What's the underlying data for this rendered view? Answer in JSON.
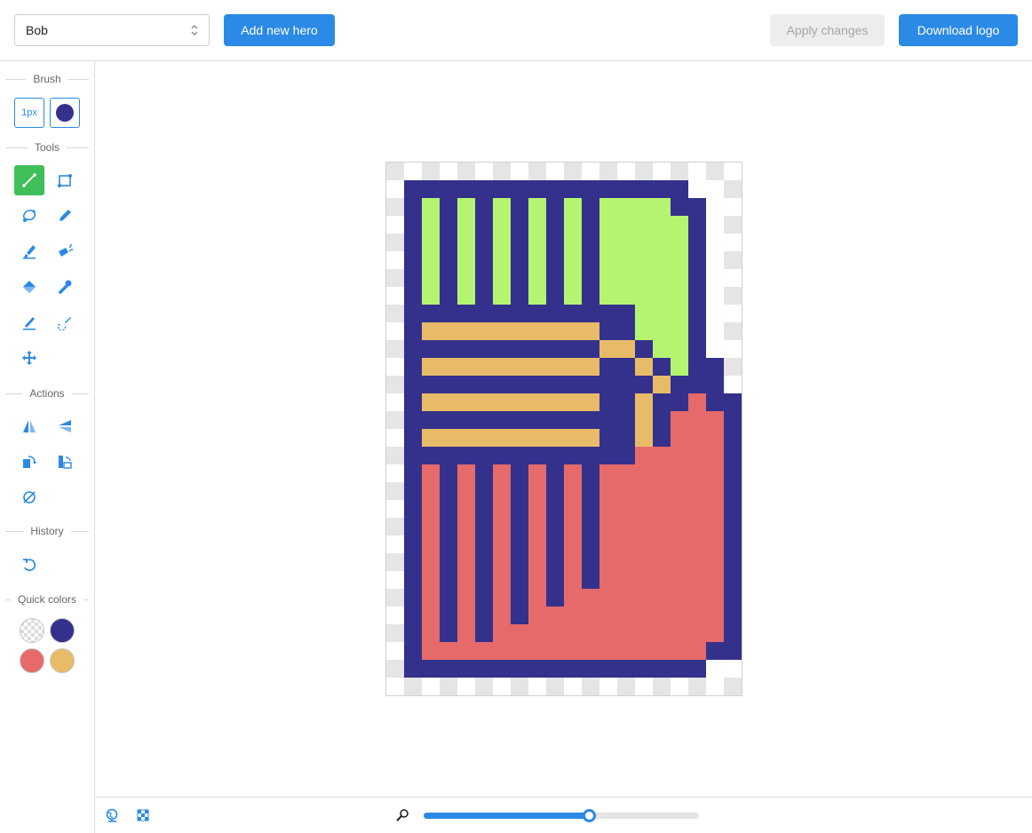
{
  "header": {
    "hero_select": {
      "value": "Bob"
    },
    "add_hero_label": "Add new hero",
    "apply_label": "Apply changes",
    "download_label": "Download logo"
  },
  "sidebar": {
    "brush": {
      "title": "Brush",
      "size_label": "1px",
      "color": "#34318c"
    },
    "tools": {
      "title": "Tools",
      "items": [
        {
          "name": "line-tool",
          "icon": "line-icon",
          "active": true
        },
        {
          "name": "rectangle-tool",
          "icon": "rectangle-select-icon",
          "active": false
        },
        {
          "name": "lasso-tool",
          "icon": "lasso-icon",
          "active": false
        },
        {
          "name": "pencil-tool",
          "icon": "pencil-icon",
          "active": false
        },
        {
          "name": "marker-tool",
          "icon": "marker-icon",
          "active": false
        },
        {
          "name": "spray-tool",
          "icon": "spray-icon",
          "active": false
        },
        {
          "name": "fill-tool",
          "icon": "paint-bucket-icon",
          "active": false
        },
        {
          "name": "eyedropper-tool",
          "icon": "eyedropper-icon",
          "active": false
        },
        {
          "name": "eraser-tool",
          "icon": "eraser-icon",
          "active": false
        },
        {
          "name": "color-replace-tool",
          "icon": "color-replace-icon",
          "active": false
        },
        {
          "name": "move-tool",
          "icon": "move-icon",
          "active": false
        }
      ]
    },
    "actions": {
      "title": "Actions",
      "items": [
        {
          "name": "flip-horizontal",
          "icon": "flip-horizontal-icon"
        },
        {
          "name": "flip-vertical",
          "icon": "flip-vertical-icon"
        },
        {
          "name": "rotate-right",
          "icon": "rotate-right-icon"
        },
        {
          "name": "rotate-left",
          "icon": "rotate-left-icon"
        },
        {
          "name": "clear",
          "icon": "clear-icon"
        }
      ]
    },
    "history": {
      "title": "History",
      "items": [
        {
          "name": "undo",
          "icon": "undo-icon"
        }
      ]
    },
    "quick_colors": {
      "title": "Quick colors",
      "items": [
        "transparent",
        "#34318c",
        "#e66a6a",
        "#e8bb68"
      ]
    }
  },
  "canvas": {
    "palette": {
      "B": "#34318c",
      "G": "#b5f471",
      "O": "#e8bb68",
      "R": "#e66a6a",
      "W": "#ffffff",
      "T1": "#ffffff",
      "T2": "#e5e5e5"
    },
    "grid": [
      "....................",
      ".BBBBBBBBBBBBBBBBW..",
      ".BGBGBGBGBGBGGGGBBW.",
      ".BGBGBGBGBGBGGGGGBW.",
      ".BGBGBGBGBGBGGGGGBW.",
      ".BGBGBGBGBGBGGGGGBW.",
      ".BGBGBGBGBGBGGGGGBW.",
      ".BGBGBGBGBGBGGGGGBW.",
      ".BBBBBBBBBBBBBGGGBW.",
      ".BOOOOOOOOOOBBGGGBW.",
      ".BBBBBBBBBBBOOBGGBW.",
      ".BOOOOOOOOOOBBOBGBB.",
      ".BBBBBBBBBBBBBBOBBBW",
      ".BOOOOOOOOOOBBOBBRBB",
      ".BBBBBBBBBBBBBOBRRRB",
      ".BOOOOOOOOOOBBOBRRRB",
      ".BBBBBBBBBBBBBRRRRRB",
      ".BRBRBRBRBRBRRRRRRRB",
      ".BRBRBRBRBRBRRRRRRRB",
      ".BRBRBRBRBRBRRRRRRRB",
      ".BRBRBRBRBRBRRRRRRRB",
      ".BRBRBRBRBRBRRRRRRRB",
      ".BRBRBRBRBRBRRRRRRRB",
      ".BRBRBRBRBRBRRRRRRRB",
      ".BRBRBRBRBRRRRRRRRRB",
      ".BRBRBRBRRRRRRRRRRRB",
      ".BRBRBRRRRRRRRRRRRRB",
      ".BRRRRRRRRRRRRRRRRBB",
      ".BBBBBBBBBBBBBBBBBW.",
      "...................."
    ]
  },
  "footer": {
    "zoom_value": 0.6
  }
}
